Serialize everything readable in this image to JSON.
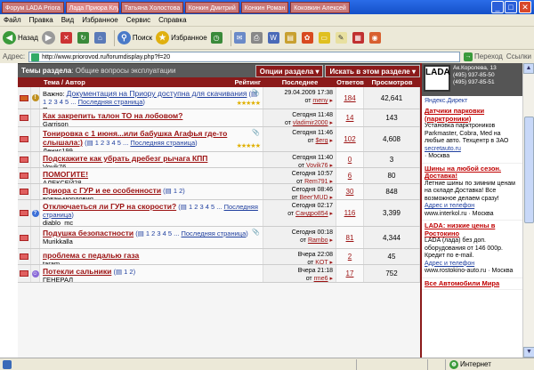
{
  "window": {
    "tabs": [
      "Форум LADA Priora",
      "Лада Приора Клуб",
      "Татьяна Холостова",
      "Конкин Дмитрий",
      "Конкин Роман",
      "Коковкин Алексей"
    ],
    "title": "Лада Приора Club - Microsoft Internet Explorer",
    "min": "_",
    "max": "□",
    "close": "✕"
  },
  "menu": [
    "Файл",
    "Правка",
    "Вид",
    "Избранное",
    "Сервис",
    "Справка"
  ],
  "toolbar": {
    "back": "Назад",
    "search": "Поиск",
    "favorites": "Избранное"
  },
  "address": {
    "label": "Адрес:",
    "url": "http://www.priorovod.ru/forumdisplay.php?f=20",
    "go": "Переход",
    "links": "Ссылки"
  },
  "section": {
    "title": "Темы раздела",
    "sub": ": Общие вопросы эксплуатации",
    "options": "Опции раздела",
    "search": "Искать в этом разделе"
  },
  "columns": {
    "topic": "Тема / Автор",
    "rating": "Рейтинг",
    "last": "Последнее сообщение",
    "replies": "Ответов",
    "views": "Просмотров"
  },
  "threads": [
    {
      "prefix": "Важно: ",
      "title": "Документация на Приору доступна для скачивания",
      "pages": "1 2 3 4 5",
      "lastpage": "Последняя страница",
      "author": "Путинка",
      "date": "29.04.2009 17:38",
      "by": "meny",
      "replies": "184",
      "views": "42,641",
      "bold": false,
      "stars": "★★★★★",
      "attach": "📎"
    },
    {
      "prefix": "",
      "title": "Как закрепить талон ТО на лобовом?",
      "pages": "",
      "lastpage": "",
      "author": "Garrison",
      "date": "Сегодня 11:48",
      "by": "vladimir2000",
      "replies": "14",
      "views": "143",
      "bold": true,
      "stars": "",
      "attach": ""
    },
    {
      "prefix": "",
      "title": "Тонировка с 1 июня...или бабушка Агафья где-то слышала:)",
      "pages": "1 2 3 4 5",
      "lastpage": "Последняя страница",
      "author": "Денис199",
      "date": "Сегодня 11:46",
      "by": "$erg",
      "replies": "102",
      "views": "4,608",
      "bold": true,
      "stars": "★★★★★",
      "attach": "📎"
    },
    {
      "prefix": "",
      "title": "Подскажите как убрать дребезг рычага КПП",
      "pages": "",
      "lastpage": "",
      "author": "Vovik76",
      "date": "Сегодня 11:40",
      "by": "Vovik76",
      "replies": "0",
      "views": "3",
      "bold": true,
      "stars": "",
      "attach": ""
    },
    {
      "prefix": "",
      "title": "ПОМОГИТЕ!",
      "pages": "",
      "lastpage": "",
      "author": "АЛЕКСЕЙ28",
      "date": "Сегодня 10:57",
      "by": "Rem791",
      "replies": "6",
      "views": "80",
      "bold": true,
      "stars": "",
      "attach": ""
    },
    {
      "prefix": "",
      "title": "Приора с ГУР и ее особенности",
      "pages": "1 2",
      "lastpage": "",
      "author": "вован-мордовия",
      "date": "Сегодня 08:46",
      "by": "Beer'MUD",
      "replies": "30",
      "views": "848",
      "bold": true,
      "stars": "",
      "attach": ""
    },
    {
      "prefix": "",
      "title": "Отключаеться ли ГУР на скорости?",
      "pages": "1 2 3 4 5",
      "lastpage": "Последняя страница",
      "author": "diablo_mc",
      "date": "Сегодня 02:17",
      "by": "Сандро854",
      "replies": "116",
      "views": "3,399",
      "bold": true,
      "stars": "",
      "attach": ""
    },
    {
      "prefix": "",
      "title": "Подушка безопастности",
      "pages": "1 2 3 4 5",
      "lastpage": "Последняя страница",
      "author": "Murikkalla",
      "date": "Сегодня 00:18",
      "by": "Rambo",
      "replies": "81",
      "views": "4,344",
      "bold": true,
      "stars": "",
      "attach": "📎"
    },
    {
      "prefix": "",
      "title": "проблема с педалью газа",
      "pages": "",
      "lastpage": "",
      "author": "taram",
      "date": "Вчера 22:08",
      "by": "KOT",
      "replies": "2",
      "views": "45",
      "bold": true,
      "stars": "",
      "attach": ""
    },
    {
      "prefix": "",
      "title": "Потекли сальники",
      "pages": "1 2",
      "lastpage": "",
      "author": "ГЕНЕРАЛ",
      "date": "Вчера 21:18",
      "by": "rme6",
      "replies": "17",
      "views": "752",
      "bold": true,
      "stars": "",
      "attach": ""
    }
  ],
  "sidebar": {
    "logo": "LADA",
    "info": [
      "Ак.Королева, 13",
      "(495) 937-85-50",
      "(495) 937-85-51"
    ],
    "yandex": "Яндекс.Директ",
    "ads": [
      {
        "head": "Датчики парковки (парктроники)",
        "body": "Установка парктроников Parkmaster, Cobra, Med на любые авто. Техцентр в ЗАО",
        "site": "secretauto.ru",
        "city": "· Москва"
      },
      {
        "head": "Шины на любой сезон. Доставка!",
        "body": "Летние шины по зимним ценам на складе.Доставка! Все возможное делаем сразу!",
        "site": "Адрес и телефон",
        "city": "www.interkol.ru · Москва"
      },
      {
        "head": "LADA: низкие цены в Ростокино",
        "body": "LADA (лада) без доп. оборудования от 146 000р. Кредит по e-mail.",
        "site": "Адрес и телефон",
        "city": "www.rostokino-auto.ru · Москва"
      },
      {
        "head": "Все Автомобили Мира",
        "body": "",
        "site": "",
        "city": ""
      }
    ]
  },
  "status": {
    "zone": "Интернет",
    "done": ""
  }
}
